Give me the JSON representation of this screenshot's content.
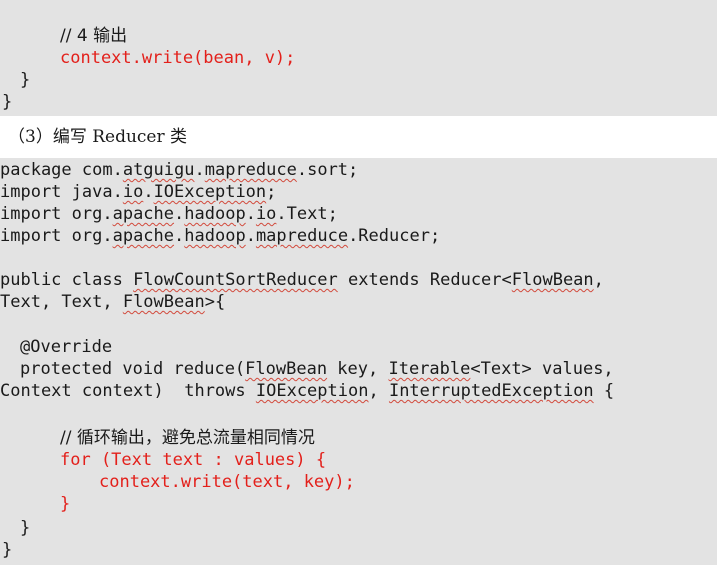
{
  "top_code": {
    "comment": "// 4 输出",
    "call": "context.write(bean, v);",
    "close1": "}",
    "close2": "}"
  },
  "heading": "（3）编写 Reducer 类",
  "code": {
    "package": [
      "package com.",
      "atguigu",
      ".",
      "mapreduce",
      ".sort;"
    ],
    "imp1": [
      "import java.",
      "io",
      ".",
      "IOException",
      ";"
    ],
    "imp2": [
      "import org.",
      "apache",
      ".",
      "hadoop",
      ".",
      "io",
      ".Text;"
    ],
    "imp3": [
      "import org.",
      "apache",
      ".",
      "hadoop",
      ".",
      "mapreduce",
      ".Reducer;"
    ],
    "cls": [
      "public class ",
      "FlowCountSortReducer",
      " extends Reducer<",
      "FlowBean",
      ","
    ],
    "cls2": [
      "Text, Text, ",
      "FlowBean",
      ">{"
    ],
    "override": "@Override",
    "reduce": [
      "protected void reduce(",
      "FlowBean",
      " key, ",
      "Iterable",
      "<Text> values,"
    ],
    "reduce2": [
      "Context context)  throws ",
      "IOException",
      ", ",
      "InterruptedException",
      " {"
    ],
    "comment2": "// 循环输出，避免总流量相同情况",
    "for": "for (Text text : values) {",
    "write": "context.write(text, key);",
    "close_for": "}",
    "close_method": "}",
    "close_class": "}"
  }
}
